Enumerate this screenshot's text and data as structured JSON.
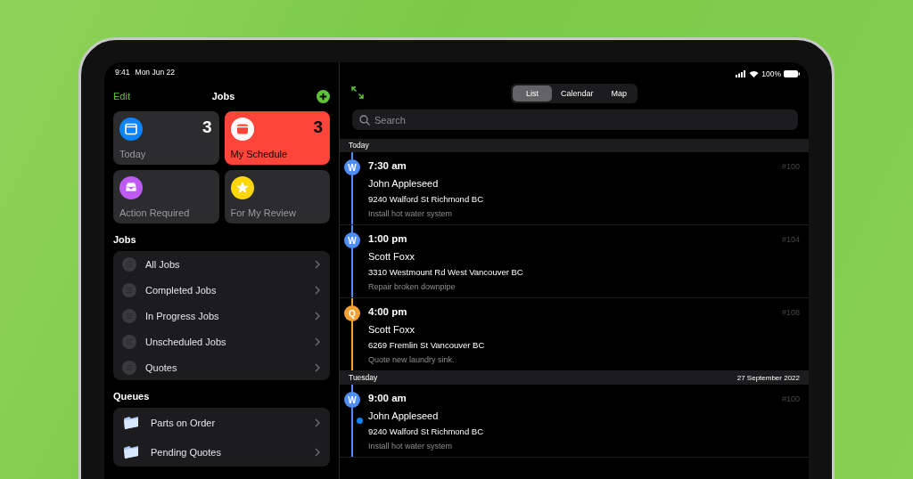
{
  "status_bar": {
    "time": "9:41",
    "date": "Mon Jun 22",
    "battery": "100%"
  },
  "sidebar": {
    "edit": "Edit",
    "title": "Jobs",
    "tiles": [
      {
        "label": "Today",
        "count": "3",
        "color": "#0a84ff",
        "kind": "calendar",
        "selected": false
      },
      {
        "label": "My Schedule",
        "count": "3",
        "color": "#ff453a",
        "kind": "calendar",
        "selected": true
      },
      {
        "label": "Action Required",
        "color": "#bf5af2",
        "kind": "tray",
        "selected": false
      },
      {
        "label": "For My Review",
        "color": "#ffd60a",
        "kind": "star",
        "selected": false
      }
    ],
    "sections": [
      {
        "title": "Jobs",
        "kind": "list",
        "items": [
          "All Jobs",
          "Completed Jobs",
          "In Progress Jobs",
          "Unscheduled Jobs",
          "Quotes"
        ]
      },
      {
        "title": "Queues",
        "kind": "folder",
        "items": [
          "Parts on Order",
          "Pending Quotes"
        ]
      }
    ]
  },
  "detail": {
    "segments": [
      {
        "label": "List",
        "selected": true
      },
      {
        "label": "Calendar",
        "selected": false
      },
      {
        "label": "Map",
        "selected": false
      }
    ],
    "search": {
      "placeholder": "Search"
    },
    "groups": [
      {
        "day": "Today",
        "jobs": [
          {
            "badge": "W",
            "color": "#4f8ef7",
            "time": "7:30 am",
            "number": "#100",
            "name": "John Appleseed",
            "address": "9240 Walford St Richmond BC",
            "description": "Install hot water system",
            "unread": false
          },
          {
            "badge": "W",
            "color": "#4f8ef7",
            "time": "1:00 pm",
            "number": "#104",
            "name": "Scott Foxx",
            "address": "3310 Westmount Rd West Vancouver BC",
            "description": "Repair broken downpipe",
            "unread": false
          },
          {
            "badge": "Q",
            "color": "#f5a030",
            "time": "4:00 pm",
            "number": "#108",
            "name": "Scott Foxx",
            "address": "6269 Fremlin St Vancouver BC",
            "description": "Quote new laundry sink.",
            "unread": false
          }
        ]
      },
      {
        "day": "Tuesday",
        "date": "27 September 2022",
        "jobs": [
          {
            "badge": "W",
            "color": "#4f8ef7",
            "time": "9:00 am",
            "number": "#100",
            "name": "John Appleseed",
            "address": "9240 Walford St Richmond BC",
            "description": "Install hot water system",
            "unread": true
          }
        ]
      }
    ]
  }
}
